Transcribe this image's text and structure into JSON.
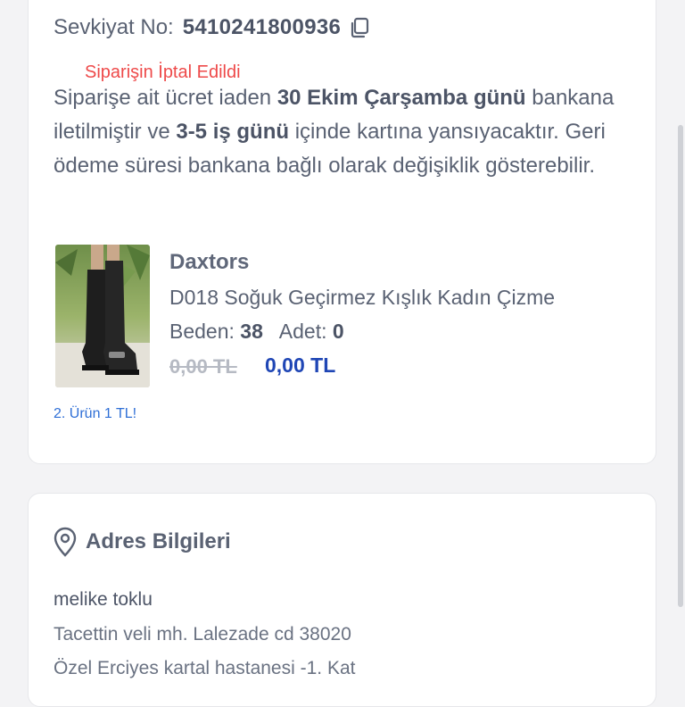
{
  "shipment": {
    "label": "Sevkiyat No:",
    "number": "5410241800936"
  },
  "order": {
    "status": "Siparişin İptal Edildi",
    "refund_p1": "Siparişe ait ücret iaden ",
    "refund_date": "30 Ekim Çarşamba günü",
    "refund_p2": " bankana iletilmiştir ve ",
    "refund_days": "3-5 iş günü",
    "refund_p3": " içinde kartına yansıyacaktır. Geri ödeme süresi bankana bağlı olarak değişiklik gösterebilir."
  },
  "product": {
    "brand": "Daxtors",
    "name": "D018  Soğuk Geçirmez Kışlık Kadın Çizme",
    "size_label": "Beden:",
    "size": "38",
    "qty_label": "Adet:",
    "qty": "0",
    "old_price": "0,00 TL",
    "price": "0,00 TL",
    "promo": "2. Ürün 1 TL!"
  },
  "address": {
    "title": "Adres Bilgileri",
    "name": "melike  toklu",
    "line1": "Tacettin veli mh. Lalezade cd 38020",
    "line2": "Özel Erciyes kartal hastanesi -1. Kat"
  },
  "colors": {
    "status_red": "#ee4a4a",
    "price_blue": "#1f46b5",
    "promo_blue": "#2f6fd6"
  },
  "icons": {
    "copy": "copy-icon",
    "location": "location-pin-icon"
  }
}
